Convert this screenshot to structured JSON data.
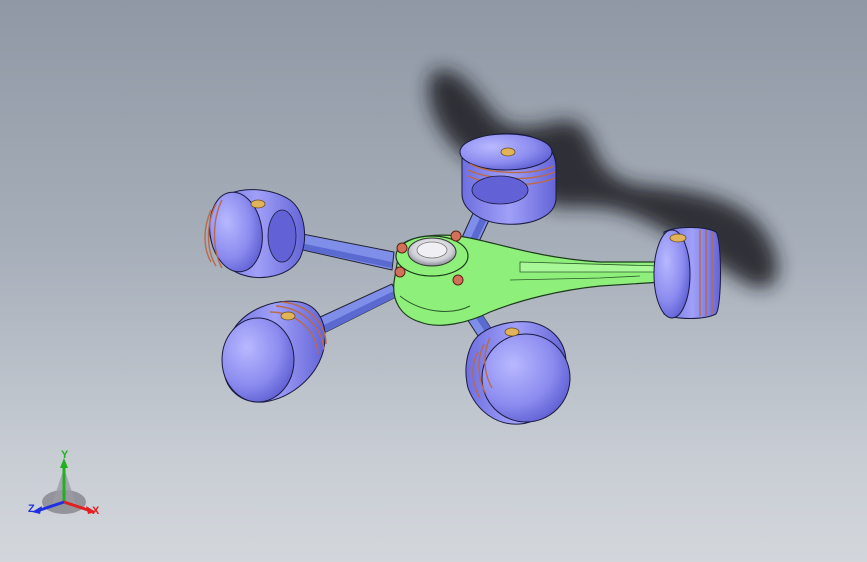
{
  "colors": {
    "background_top": "#8f98a4",
    "background_bottom": "#d3d7dc",
    "piston_fill": "#8c8cf0",
    "piston_dark": "#5a5ad0",
    "ring_color": "#b86a4a",
    "master_rod": "#8ef07a",
    "link_rod": "#7f8ee8",
    "pin_color": "#e2b45a",
    "bolt_color": "#d2705a",
    "shadow": "#1e1e22"
  },
  "triad": {
    "x_label": "X",
    "y_label": "Y",
    "z_label": "Z",
    "x_color": "#e02020",
    "y_color": "#20b020",
    "z_color": "#2030e0"
  }
}
